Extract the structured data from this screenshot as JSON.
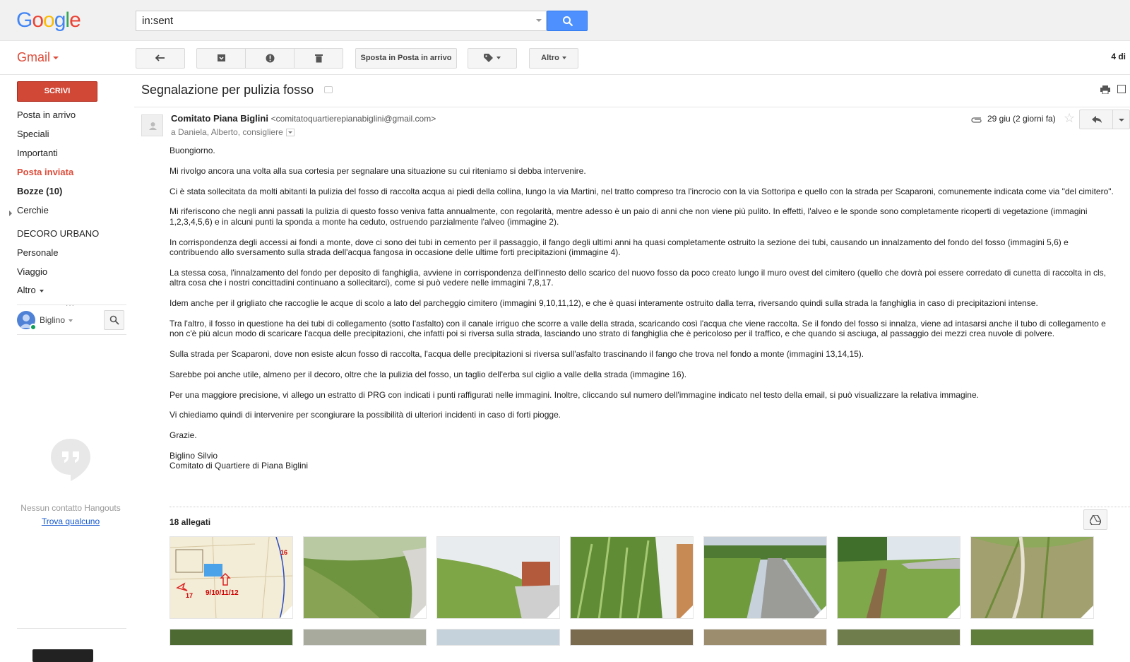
{
  "header": {
    "logo": "Google",
    "search_value": "in:sent"
  },
  "toolbar": {
    "app_label": "Gmail",
    "move_to_inbox": "Sposta in Posta in arrivo",
    "more_label": "Altro",
    "counter": "4 di"
  },
  "sidebar": {
    "compose_label": "SCRIVI",
    "items": [
      {
        "label": "Posta in arrivo"
      },
      {
        "label": "Speciali"
      },
      {
        "label": "Importanti"
      },
      {
        "label": "Posta inviata"
      },
      {
        "label": "Bozze (10)"
      },
      {
        "label": "Cerchie"
      },
      {
        "label": "DECORO URBANO"
      },
      {
        "label": "Personale"
      },
      {
        "label": "Viaggio"
      },
      {
        "label": "Altro"
      }
    ],
    "user_name": "Biglino",
    "hangouts_empty": "Nessun contatto Hangouts",
    "hangouts_find": "Trova qualcuno"
  },
  "email": {
    "subject": "Segnalazione per pulizia fosso",
    "sender_name": "Comitato Piana Biglini",
    "sender_email": "<comitatoquartierepianabiglini@gmail.com>",
    "recipients": "a Daniela, Alberto, consigliere",
    "date": "29 giu (2 giorni fa)",
    "paragraphs": [
      "Buongiorno.",
      "Mi rivolgo ancora una volta alla sua cortesia per segnalare una situazione su cui riteniamo si debba intervenire.",
      "Ci è stata sollecitata da molti abitanti la pulizia del fosso di raccolta acqua ai piedi della collina, lungo la via Martini, nel tratto compreso tra l'incrocio con la via Sottoripa e quello con la strada per Scaparoni, comunemente indicata come via \"del cimitero\".",
      "Mi riferiscono che negli anni passati la pulizia di questo fosso veniva fatta annualmente, con regolarità, mentre adesso è un paio di anni che non viene più pulito. In effetti, l'alveo e le sponde sono completamente ricoperti di vegetazione (immagini 1,2,3,4,5,6) e in alcuni punti la sponda a monte ha ceduto, ostruendo parzialmente l'alveo (immagine 2).",
      "In corrispondenza degli accessi ai fondi a monte, dove ci sono dei tubi in cemento per il passaggio, il fango degli ultimi anni ha quasi completamente ostruito la sezione dei tubi, causando un innalzamento del fondo del fosso (immagini 5,6) e contribuendo allo sversamento sulla strada dell'acqua fangosa in occasione delle ultime forti precipitazioni (immagine 4).",
      "La stessa cosa, l'innalzamento del fondo per deposito di fanghiglia, avviene in corrispondenza dell'innesto  dello scarico del nuovo fosso da poco creato lungo il muro ovest del cimitero (quello che dovrà poi essere corredato di cunetta di raccolta in cls, altra cosa che i nostri concittadini continuano a sollecitarci), come si può vedere nelle immagini 7,8,17.",
      "Idem anche per il grigliato che raccoglie le acque di scolo a lato del parcheggio cimitero (immagini 9,10,11,12), e che è quasi interamente ostruito dalla terra, riversando quindi sulla strada la fanghiglia in caso di precipitazioni intense.",
      "Tra l'altro, il fosso in questione ha dei tubi di collegamento (sotto l'asfalto) con il canale irriguo che scorre a valle della strada, scaricando così l'acqua che viene raccolta. Se il fondo del fosso si innalza, viene ad intasarsi anche il tubo di collegamento e non c'è più alcun modo di scaricare l'acqua delle precipitazioni, che infatti poi si riversa sulla strada, lasciando uno strato di fanghiglia che è pericoloso per il traffico, e che quando si asciuga, al passaggio dei mezzi crea nuvole di polvere.",
      "Sulla strada per Scaparoni, dove non esiste alcun fosso di raccolta, l'acqua delle precipitazioni si riversa sull'asfalto trascinando il fango che trova nel fondo a monte (immagini 13,14,15).",
      "Sarebbe poi anche utile, almeno per il decoro, oltre che la pulizia del fosso, un taglio dell'erba sul ciglio a valle della strada (immagine 16).",
      "Per una maggiore precisione, vi allego un estratto di PRG con indicati i punti raffigurati nelle immagini. Inoltre, cliccando sul numero dell'immagine indicato nel testo della email, si può visualizzare la relativa immagine.",
      "Vi chiediamo quindi di intervenire per scongiurare la possibilità di ulteriori incidenti in caso di forti piogge.",
      "Grazie."
    ],
    "signature_name": "Biglino Silvio",
    "signature_org": "Comitato di Quartiere di Piana Biglini",
    "attachments_title": "18 allegati",
    "map_label_9": "9/10/11/12",
    "map_label_17": "17",
    "map_label_16": "16"
  },
  "colors": {
    "accent_red": "#dd4b39",
    "search_blue": "#4d90fe",
    "link_blue": "#1155cc"
  }
}
